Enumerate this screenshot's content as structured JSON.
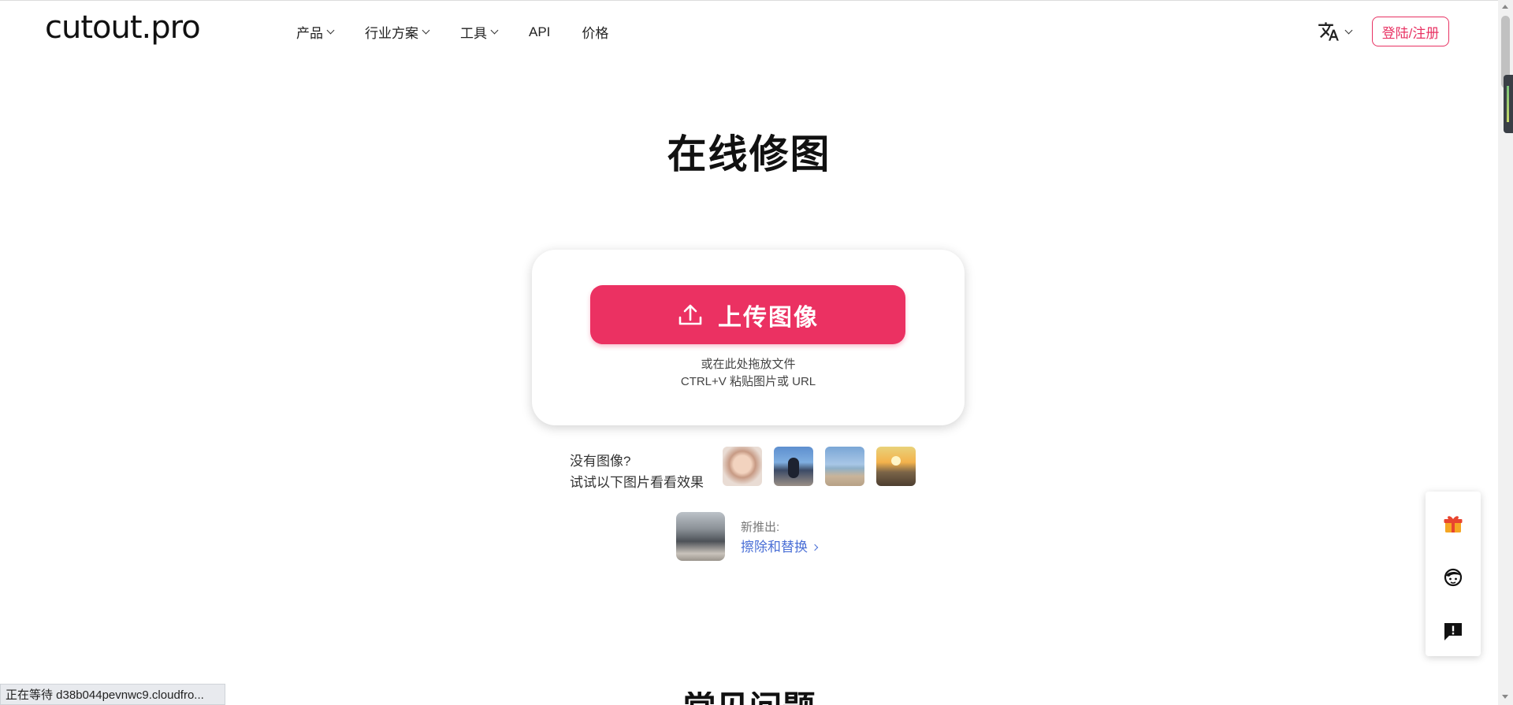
{
  "header": {
    "logo": "cutout.pro",
    "nav": [
      {
        "label": "产品",
        "has_dropdown": true
      },
      {
        "label": "行业方案",
        "has_dropdown": true
      },
      {
        "label": "工具",
        "has_dropdown": true
      },
      {
        "label": "API",
        "has_dropdown": false
      },
      {
        "label": "价格",
        "has_dropdown": false
      }
    ],
    "language_icon": "translate-icon",
    "login_label": "登陆/注册"
  },
  "main": {
    "title": "在线修图",
    "upload": {
      "button_label": "上传图像",
      "icon": "upload-icon",
      "hint_drop": "或在此处拖放文件",
      "hint_paste": "CTRL+V 粘贴图片或 URL"
    },
    "samples": {
      "line1": "没有图像?",
      "line2": "试试以下图片看看效果"
    },
    "new_feature": {
      "label": "新推出:",
      "link": "擦除和替换"
    },
    "next_section_heading": "常见问题"
  },
  "side_panel": {
    "icons": [
      "gift-icon",
      "support-agent-icon",
      "feedback-icon"
    ]
  },
  "status_bar": {
    "text": "正在等待 d38b044pevnwc9.cloudfro..."
  },
  "colors": {
    "brand": "#eb3162",
    "link": "#4a6fd6"
  }
}
